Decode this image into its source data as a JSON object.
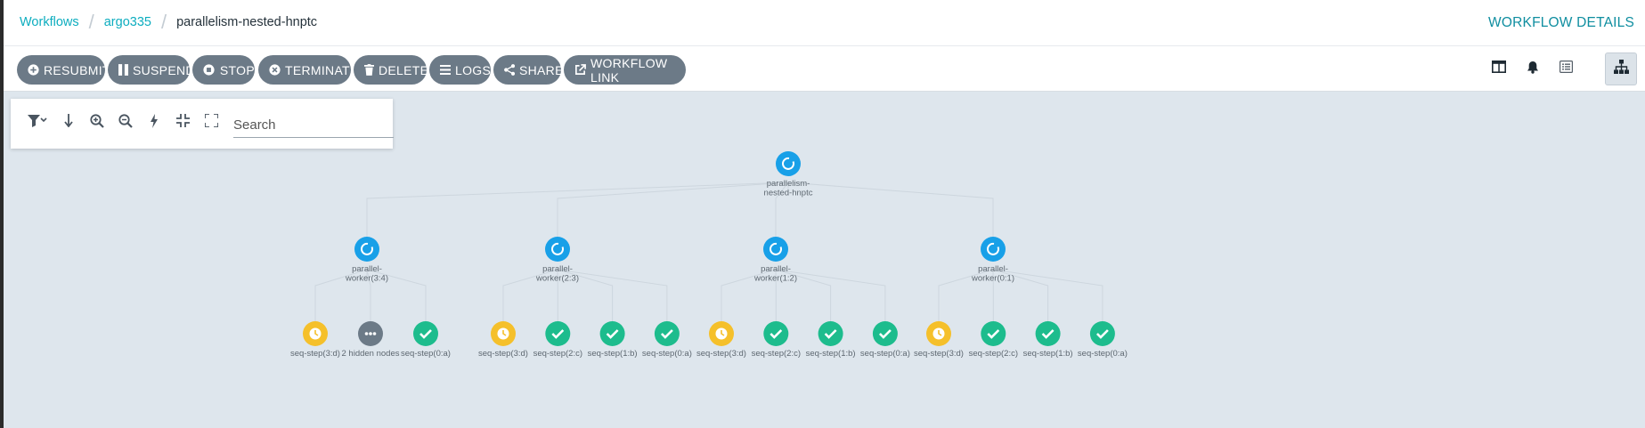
{
  "breadcrumb": [
    "Workflows",
    "argo335",
    "parallelism-nested-hnptc"
  ],
  "page_title": "WORKFLOW DETAILS",
  "toolbar": {
    "buttons": [
      {
        "label": "RESUBMIT",
        "icon": "plus-circle-icon"
      },
      {
        "label": "SUSPEND",
        "icon": "pause-icon"
      },
      {
        "label": "STOP",
        "icon": "stop-circle-icon"
      },
      {
        "label": "TERMINATE",
        "icon": "times-circle-icon"
      },
      {
        "label": "DELETE",
        "icon": "trash-icon"
      },
      {
        "label": "LOGS",
        "icon": "bars-icon"
      },
      {
        "label": "SHARE",
        "icon": "share-icon"
      },
      {
        "label": "WORKFLOW LINK",
        "icon": "external-link-icon"
      }
    ],
    "view_buttons": [
      "columns-icon",
      "bell-icon",
      "list-alt-icon",
      "sitemap-icon"
    ],
    "active_view": "sitemap-icon"
  },
  "graph_controls": {
    "icons": [
      "filter-icon",
      "arrow-down-icon",
      "zoom-in-icon",
      "zoom-out-icon",
      "bolt-icon",
      "compress-icon",
      "expand-icon"
    ],
    "search_placeholder": "Search"
  },
  "colors": {
    "running": "#18a0e8",
    "pending": "#f5c02b",
    "succeeded": "#1dbc8d",
    "hidden": "#6c7a87",
    "accent": "#0dadbf"
  },
  "graph": {
    "root": {
      "label": [
        "parallelism-",
        "nested-hnptc"
      ],
      "status": "running"
    },
    "workers": [
      {
        "label": [
          "parallel-",
          "worker(3:4)"
        ],
        "status": "running",
        "children": [
          {
            "label": "seq-step(3:d)",
            "status": "pending"
          },
          {
            "label": "2 hidden nodes",
            "status": "hidden"
          },
          {
            "label": "seq-step(0:a)",
            "status": "succeeded"
          }
        ]
      },
      {
        "label": [
          "parallel-",
          "worker(2:3)"
        ],
        "status": "running",
        "children": [
          {
            "label": "seq-step(3:d)",
            "status": "pending"
          },
          {
            "label": "seq-step(2:c)",
            "status": "succeeded"
          },
          {
            "label": "seq-step(1:b)",
            "status": "succeeded"
          },
          {
            "label": "seq-step(0:a)",
            "status": "succeeded"
          }
        ]
      },
      {
        "label": [
          "parallel-",
          "worker(1:2)"
        ],
        "status": "running",
        "children": [
          {
            "label": "seq-step(3:d)",
            "status": "pending"
          },
          {
            "label": "seq-step(2:c)",
            "status": "succeeded"
          },
          {
            "label": "seq-step(1:b)",
            "status": "succeeded"
          },
          {
            "label": "seq-step(0:a)",
            "status": "succeeded"
          }
        ]
      },
      {
        "label": [
          "parallel-",
          "worker(0:1)"
        ],
        "status": "running",
        "children": [
          {
            "label": "seq-step(3:d)",
            "status": "pending"
          },
          {
            "label": "seq-step(2:c)",
            "status": "succeeded"
          },
          {
            "label": "seq-step(1:b)",
            "status": "succeeded"
          },
          {
            "label": "seq-step(0:a)",
            "status": "succeeded"
          }
        ]
      }
    ]
  }
}
